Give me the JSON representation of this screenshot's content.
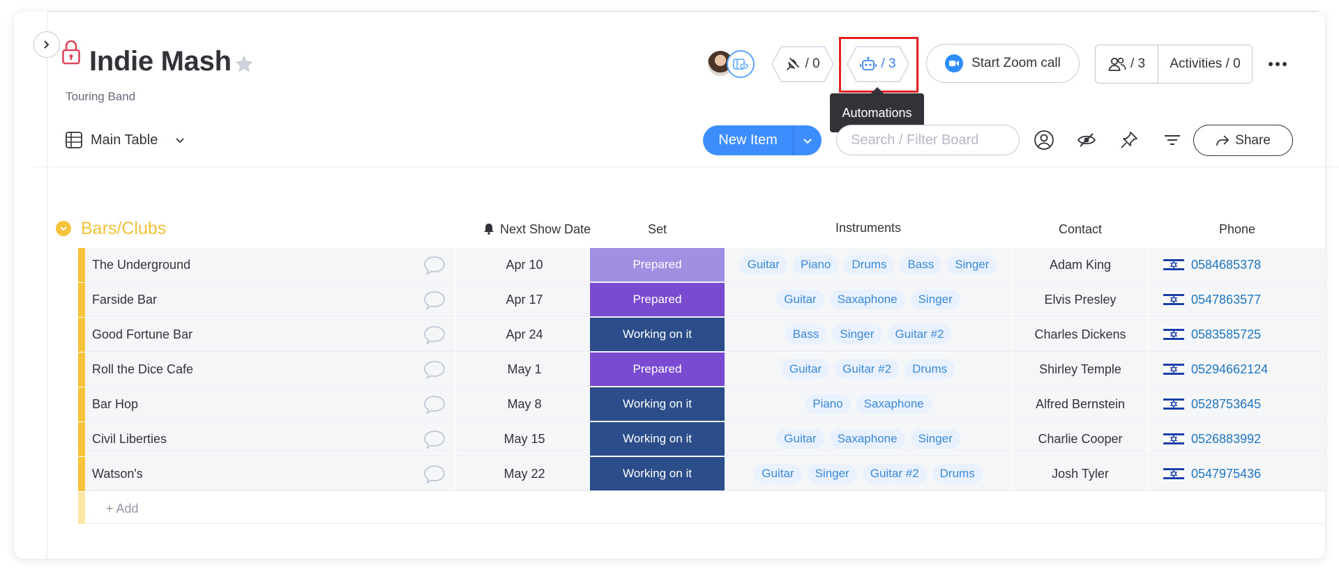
{
  "board": {
    "title": "Indie Mash",
    "subtitle": "Touring Band"
  },
  "header": {
    "integrations_count": "/ 0",
    "automations_count": "/ 3",
    "tooltip": "Automations",
    "zoom_label": "Start Zoom call",
    "people_count": "/ 3",
    "activities_label": "Activities / 0"
  },
  "toolbar": {
    "view_label": "Main Table",
    "new_item_label": "New Item",
    "search_placeholder": "Search / Filter Board",
    "share_label": "Share"
  },
  "group": {
    "title": "Bars/Clubs",
    "color": "#f7c33a",
    "add_label": "+ Add",
    "columns": {
      "date": "Next Show Date",
      "set": "Set",
      "instruments": "Instruments",
      "contact": "Contact",
      "phone": "Phone"
    },
    "rows": [
      {
        "name": "The Underground",
        "date": "Apr 10",
        "status": "Prepared",
        "status_color": "#a18fe3",
        "instruments": [
          "Guitar",
          "Piano",
          "Drums",
          "Bass",
          "Singer"
        ],
        "contact": "Adam King",
        "phone": "0584685378"
      },
      {
        "name": "Farside Bar",
        "date": "Apr 17",
        "status": "Prepared",
        "status_color": "#784bd1",
        "instruments": [
          "Guitar",
          "Saxaphone",
          "Singer"
        ],
        "contact": "Elvis Presley",
        "phone": "0547863577"
      },
      {
        "name": "Good Fortune Bar",
        "date": "Apr 24",
        "status": "Working on it",
        "status_color": "#2b4d8a",
        "instruments": [
          "Bass",
          "Singer",
          "Guitar #2"
        ],
        "contact": "Charles Dickens",
        "phone": "0583585725"
      },
      {
        "name": "Roll the Dice Cafe",
        "date": "May 1",
        "status": "Prepared",
        "status_color": "#784bd1",
        "instruments": [
          "Guitar",
          "Guitar #2",
          "Drums"
        ],
        "contact": "Shirley Temple",
        "phone": "05294662124"
      },
      {
        "name": "Bar Hop",
        "date": "May 8",
        "status": "Working on it",
        "status_color": "#2b4d8a",
        "instruments": [
          "Piano",
          "Saxaphone"
        ],
        "contact": "Alfred Bernstein",
        "phone": "0528753645"
      },
      {
        "name": "Civil Liberties",
        "date": "May 15",
        "status": "Working on it",
        "status_color": "#2b4d8a",
        "instruments": [
          "Guitar",
          "Saxaphone",
          "Singer"
        ],
        "contact": "Charlie Cooper",
        "phone": "0526883992"
      },
      {
        "name": "Watson's",
        "date": "May 22",
        "status": "Working on it",
        "status_color": "#2b4d8a",
        "instruments": [
          "Guitar",
          "Singer",
          "Guitar #2",
          "Drums"
        ],
        "contact": "Josh Tyler",
        "phone": "0547975436"
      }
    ]
  }
}
